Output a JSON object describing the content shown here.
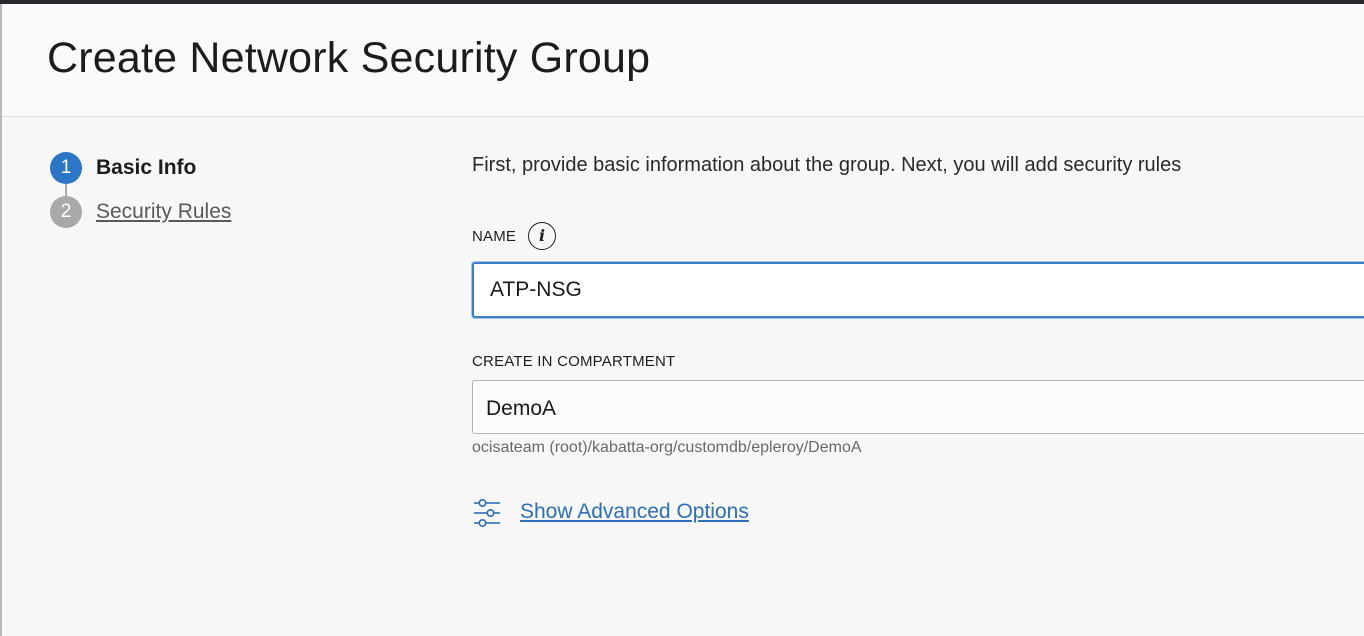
{
  "header": {
    "title": "Create Network Security Group"
  },
  "steps": [
    {
      "number": "1",
      "label": "Basic Info"
    },
    {
      "number": "2",
      "label": "Security Rules"
    }
  ],
  "form": {
    "intro": "First, provide basic information about the group. Next, you will add security rules",
    "name_label": "NAME",
    "name_value": "ATP-NSG",
    "compartment_label": "CREATE IN COMPARTMENT",
    "compartment_value": "DemoA",
    "compartment_path": "ocisateam (root)/kabatta-org/customdb/epleroy/DemoA",
    "advanced_options_link": "Show Advanced Options"
  },
  "icons": {
    "info": "info-icon",
    "advanced": "sliders-icon"
  },
  "colors": {
    "accent": "#2c76c8",
    "link": "#2c6fbd",
    "step_inactive": "#a9a9a9"
  }
}
